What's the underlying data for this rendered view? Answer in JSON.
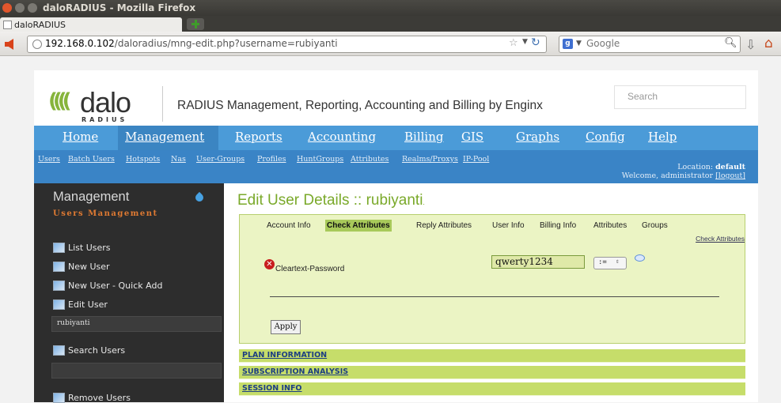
{
  "window": {
    "title": "daloRADIUS - Mozilla Firefox"
  },
  "browser": {
    "tab_label": "daloRADIUS",
    "url_host": "192.168.0.102",
    "url_path": "/daloradius/mng-edit.php?username=rubiyanti",
    "search_placeholder": "Google",
    "search_engine_glyph": "g"
  },
  "header": {
    "logo_text": "dalo",
    "logo_subtext": "RADIUS",
    "tagline": "RADIUS Management, Reporting, Accounting and Billing by Enginx",
    "search_placeholder": "Search"
  },
  "nav": {
    "items": [
      {
        "label": "Home"
      },
      {
        "label": "Management"
      },
      {
        "label": "Reports"
      },
      {
        "label": "Accounting"
      },
      {
        "label": "Billing"
      },
      {
        "label": "GIS"
      },
      {
        "label": "Graphs"
      },
      {
        "label": "Config"
      },
      {
        "label": "Help"
      }
    ],
    "active": "Management"
  },
  "subnav": {
    "items": [
      {
        "label": "Users"
      },
      {
        "label": "Batch Users"
      },
      {
        "label": "Hotspots"
      },
      {
        "label": "Nas"
      },
      {
        "label": "User-Groups"
      },
      {
        "label": "Profiles"
      },
      {
        "label": "HuntGroups"
      },
      {
        "label": "Attributes"
      },
      {
        "label": "Realms/Proxys"
      },
      {
        "label": "IP-Pool"
      }
    ],
    "location_label": "Location:",
    "location_value": "default",
    "welcome": "Welcome, administrator",
    "logout": "[logout]"
  },
  "sidebar": {
    "title": "Management",
    "subtitle": "Users Management",
    "items": [
      {
        "label": "List Users"
      },
      {
        "label": "New User"
      },
      {
        "label": "New User - Quick Add"
      },
      {
        "label": "Edit User"
      },
      {
        "label": "Search Users"
      },
      {
        "label": "Remove Users"
      }
    ],
    "edit_user_value": "rubiyanti",
    "search_value": ""
  },
  "content": {
    "title": "Edit User Details :: rubiyanti",
    "tabs": [
      {
        "label": "Account Info"
      },
      {
        "label": "Check Attributes"
      },
      {
        "label": "Reply Attributes"
      },
      {
        "label": "User Info"
      },
      {
        "label": "Billing Info"
      },
      {
        "label": "Attributes"
      },
      {
        "label": "Groups"
      }
    ],
    "active_tab": "Check Attributes",
    "section_link": "Check Attributes",
    "attribute": {
      "name": "Cleartext-Password",
      "value": "qwerty1234",
      "operator": ":="
    },
    "apply_label": "Apply",
    "sections": [
      {
        "label": "PLAN INFORMATION"
      },
      {
        "label": "SUBSCRIPTION ANALYSIS"
      },
      {
        "label": "SESSION INFO"
      }
    ]
  },
  "colors": {
    "nav_bg": "#4b9bd8",
    "subnav_bg": "#3a84c6",
    "sidebar_bg": "#2d2d2d",
    "accent_green": "#7aa92a",
    "panel_bg": "#ebf4c4",
    "section_bar": "#c6dd6a",
    "sidebar_orange": "#e07a32"
  }
}
